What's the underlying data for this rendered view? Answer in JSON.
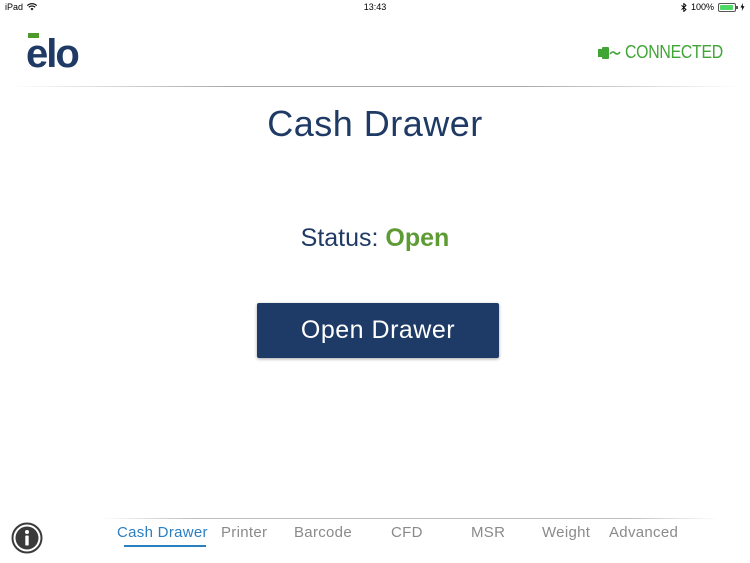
{
  "status_bar": {
    "device": "iPad",
    "time": "13:43",
    "battery": "100%",
    "battery_level": 1.0
  },
  "header": {
    "logo_text": "elo",
    "connection_status": "CONNECTED",
    "connection_icon": "plug-icon",
    "accent_color": "#3fa535"
  },
  "main": {
    "title": "Cash Drawer",
    "status_label": "Status: ",
    "status_value": "Open",
    "status_color": "#5e9b35",
    "open_button_label": "Open Drawer",
    "button_color": "#1e3b68"
  },
  "footer": {
    "info_icon": "info-icon",
    "tabs": [
      {
        "label": "Cash Drawer",
        "active": true
      },
      {
        "label": "Printer",
        "active": false
      },
      {
        "label": "Barcode",
        "active": false
      },
      {
        "label": "CFD",
        "active": false
      },
      {
        "label": "MSR",
        "active": false
      },
      {
        "label": "Weight",
        "active": false
      },
      {
        "label": "Advanced",
        "active": false
      }
    ],
    "active_color": "#2a7fc1"
  }
}
